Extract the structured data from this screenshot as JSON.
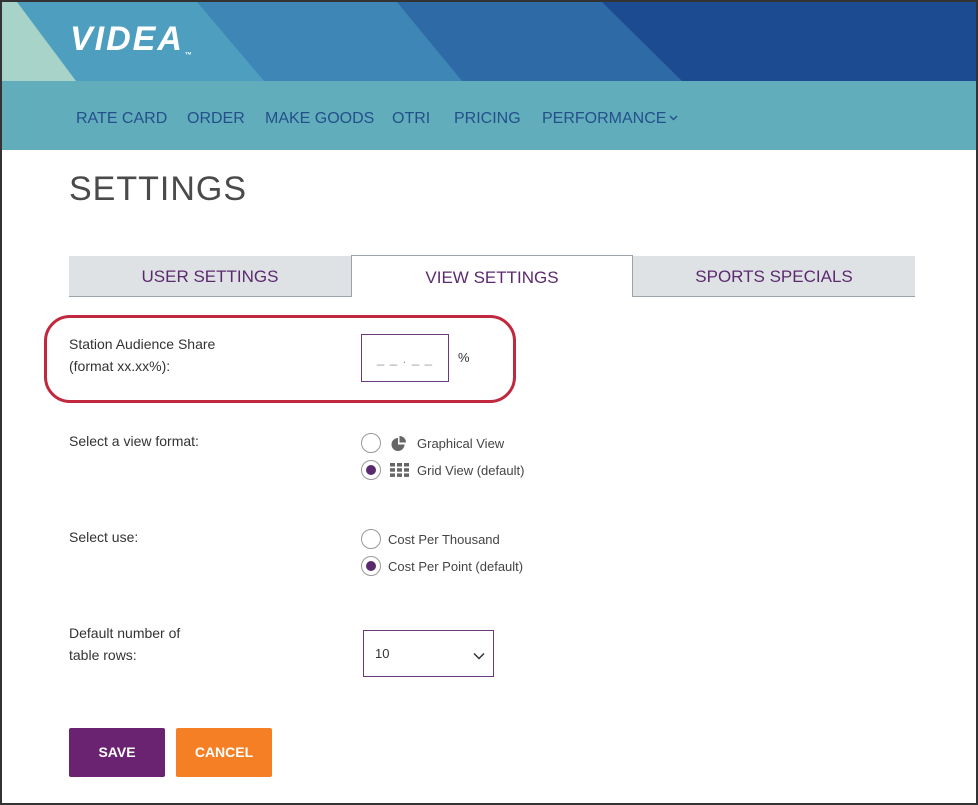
{
  "brand": {
    "logo_text": "VIDEA",
    "trademark": "™"
  },
  "nav": {
    "items": [
      {
        "label": "RATE CARD"
      },
      {
        "label": "ORDER"
      },
      {
        "label": "MAKE GOODS"
      },
      {
        "label": "OTRI"
      },
      {
        "label": "PRICING"
      },
      {
        "label": "PERFORMANCE",
        "icon": "chevron-down-icon"
      }
    ]
  },
  "page": {
    "title": "SETTINGS"
  },
  "tabs": [
    {
      "label": "USER SETTINGS",
      "active": false
    },
    {
      "label": "VIEW SETTINGS",
      "active": true
    },
    {
      "label": "SPORTS SPECIALS",
      "active": false
    }
  ],
  "form": {
    "audience_share": {
      "label_line1": "Station Audience Share",
      "label_line2": "(format xx.xx%):",
      "placeholder": "_ _ . _ _",
      "value": "",
      "suffix": "%"
    },
    "view_format": {
      "label": "Select a view format:",
      "options": [
        {
          "label": "Graphical View",
          "icon": "pie-chart-icon",
          "selected": false
        },
        {
          "label": "Grid View (default)",
          "icon": "grid-icon",
          "selected": true
        }
      ]
    },
    "use": {
      "label": "Select use:",
      "options": [
        {
          "label": "Cost Per Thousand",
          "selected": false
        },
        {
          "label": "Cost Per Point (default)",
          "selected": true
        }
      ]
    },
    "table_rows": {
      "label_line1": "Default number of",
      "label_line2": "table rows:",
      "selected_value": "10"
    }
  },
  "actions": {
    "save_label": "SAVE",
    "cancel_label": "CANCEL"
  },
  "colors": {
    "accent_purple": "#5b2a6e",
    "save_button": "#6a2370",
    "cancel_button": "#f47f24",
    "navbar": "#62adbb",
    "nav_text": "#23508b",
    "highlight": "#c0283e"
  }
}
